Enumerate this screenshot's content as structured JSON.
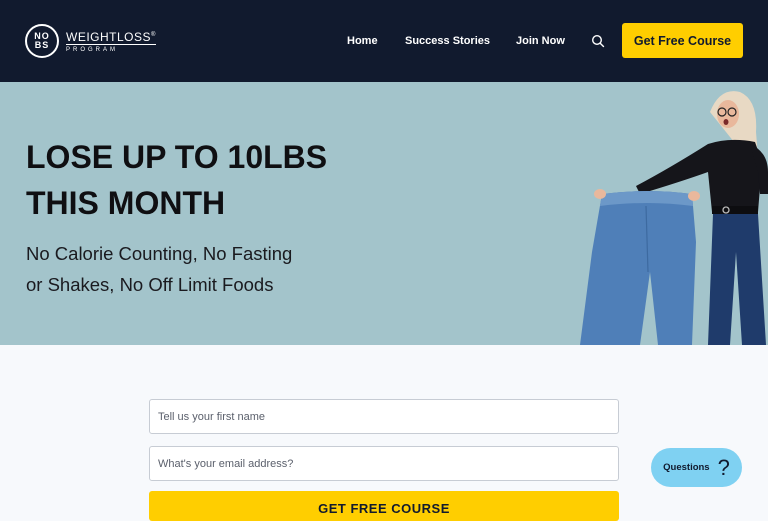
{
  "header": {
    "logo": {
      "badge_top": "NO",
      "badge_bottom": "BS",
      "title": "WEIGHTLOSS",
      "registered": "®",
      "subtitle": "PROGRAM"
    },
    "nav": [
      {
        "label": "Home"
      },
      {
        "label": "Success Stories"
      },
      {
        "label": "Join Now"
      }
    ],
    "search_icon": "search-icon",
    "cta_label": "Get Free Course"
  },
  "hero": {
    "headline_line1": "LOSE UP TO 10LBS",
    "headline_line2": "THIS MONTH",
    "subhead_line1": "No Calorie Counting, No Fasting",
    "subhead_line2": "or Shakes, No Off Limit Foods"
  },
  "form": {
    "first_name_placeholder": "Tell us your first name",
    "email_placeholder": "What's your email address?",
    "submit_label": "GET FREE COURSE"
  },
  "questions": {
    "label": "Questions",
    "icon": "?"
  },
  "colors": {
    "header_bg": "#111a2e",
    "hero_bg": "#a3c4cb",
    "accent": "#ffce00",
    "chat_bubble": "#7fd1f2"
  }
}
